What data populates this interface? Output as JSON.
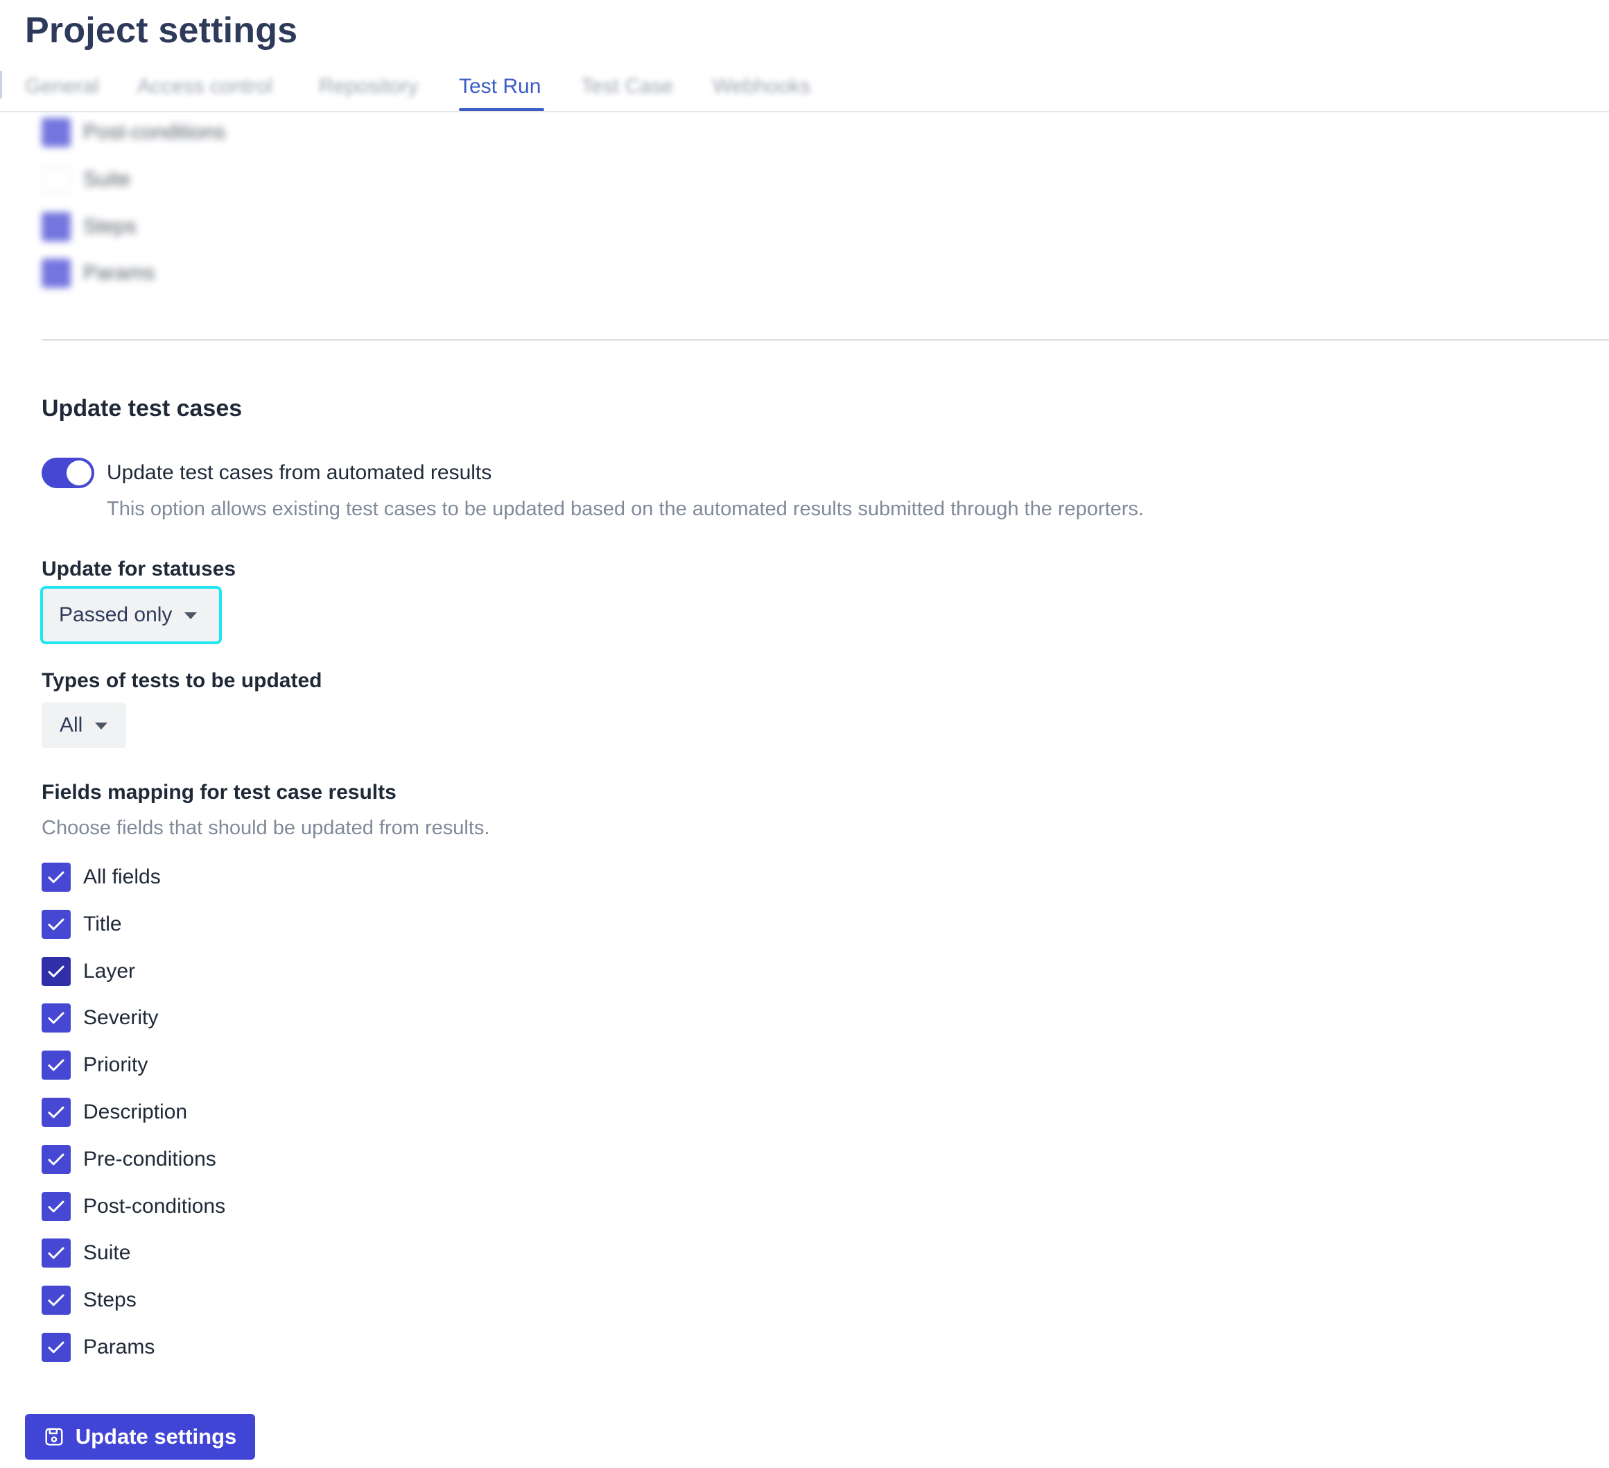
{
  "page": {
    "title": "Project settings"
  },
  "tabs": [
    {
      "label": "General"
    },
    {
      "label": "Access control"
    },
    {
      "label": "Repository"
    },
    {
      "label": "Test Run"
    },
    {
      "label": "Test Case"
    },
    {
      "label": "Webhooks"
    }
  ],
  "active_tab": "Test Run",
  "upper_fields": [
    {
      "label": "Post-conditions",
      "checked": true
    },
    {
      "label": "Suite",
      "checked": false
    },
    {
      "label": "Steps",
      "checked": true
    },
    {
      "label": "Params",
      "checked": true
    }
  ],
  "update_section": {
    "title": "Update test cases",
    "toggle": {
      "label": "Update test cases from automated results",
      "on": true,
      "help": "This option allows existing test cases to be updated based on the automated results submitted through the reporters."
    },
    "statuses": {
      "label": "Update for statuses",
      "value": "Passed only"
    },
    "types": {
      "label": "Types of tests to be updated",
      "value": "All"
    },
    "mapping": {
      "label": "Fields mapping for test case results",
      "help": "Choose fields that should be updated from results.",
      "fields": [
        {
          "label": "All fields",
          "checked": true
        },
        {
          "label": "Title",
          "checked": true
        },
        {
          "label": "Layer",
          "checked": true
        },
        {
          "label": "Severity",
          "checked": true
        },
        {
          "label": "Priority",
          "checked": true
        },
        {
          "label": "Description",
          "checked": true
        },
        {
          "label": "Pre-conditions",
          "checked": true
        },
        {
          "label": "Post-conditions",
          "checked": true
        },
        {
          "label": "Suite",
          "checked": true
        },
        {
          "label": "Steps",
          "checked": true
        },
        {
          "label": "Params",
          "checked": true
        }
      ]
    }
  },
  "submit": {
    "label": "Update settings",
    "icon": "save-icon"
  },
  "colors": {
    "accent": "#4648d4",
    "active_tab": "#3b5cc4",
    "highlight": "#1fe6f0",
    "help_text": "#808a99"
  }
}
